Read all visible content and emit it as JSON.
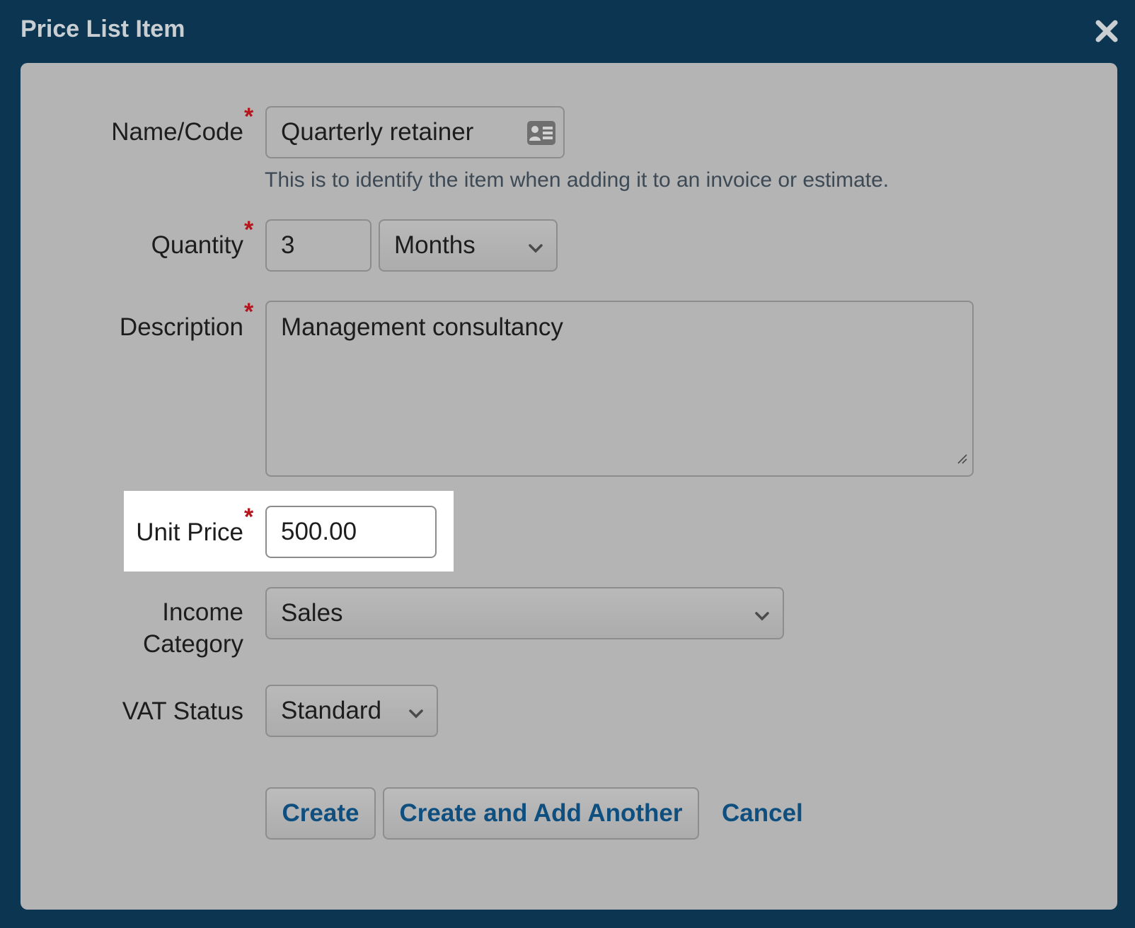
{
  "dialog": {
    "title": "Price List Item",
    "close_icon": "close-icon"
  },
  "form": {
    "name_code": {
      "label": "Name/Code",
      "required": "*",
      "value": "Quarterly retainer",
      "icon": "contact-card-icon",
      "help": "This is to identify the item when adding it to an invoice or estimate."
    },
    "quantity": {
      "label": "Quantity",
      "required": "*",
      "value": "3",
      "unit_selected": "Months"
    },
    "description": {
      "label": "Description",
      "required": "*",
      "value": "Management consultancy"
    },
    "unit_price": {
      "label": "Unit Price",
      "required": "*",
      "value": "500.00"
    },
    "income_category": {
      "label_line1": "Income",
      "label_line2": "Category",
      "selected": "Sales"
    },
    "vat_status": {
      "label": "VAT Status",
      "selected": "Standard"
    }
  },
  "actions": {
    "create": "Create",
    "create_another": "Create and Add Another",
    "cancel": "Cancel"
  },
  "colors": {
    "backdrop": "#0b3551",
    "panel": "#b4b4b4",
    "required": "#b3161c",
    "link": "#0e4f7f",
    "highlight": "#ffffff"
  }
}
